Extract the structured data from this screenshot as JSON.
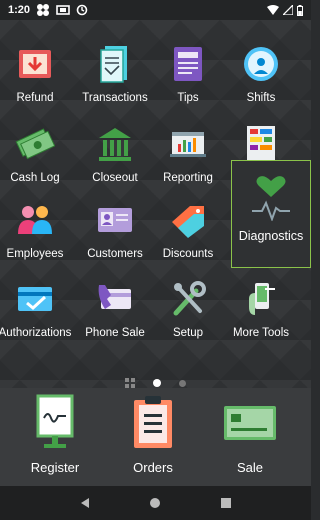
{
  "status_bar": {
    "time": "1:20",
    "icons": [
      "fan-icon",
      "cast-icon",
      "sync-icon"
    ],
    "right_icons": [
      "wifi-icon",
      "signal-icon",
      "battery-icon"
    ]
  },
  "apps": [
    {
      "label": "Refund",
      "icon": "refund-icon"
    },
    {
      "label": "Transactions",
      "icon": "transactions-icon"
    },
    {
      "label": "Tips",
      "icon": "tips-icon"
    },
    {
      "label": "Shifts",
      "icon": "shifts-icon"
    },
    {
      "label": "Cash Log",
      "icon": "cash-log-icon"
    },
    {
      "label": "Closeout",
      "icon": "closeout-icon"
    },
    {
      "label": "Reporting",
      "icon": "reporting-icon"
    },
    {
      "label": "",
      "icon": "inventory-icon"
    },
    {
      "label": "Employees",
      "icon": "employees-icon"
    },
    {
      "label": "Customers",
      "icon": "customers-icon"
    },
    {
      "label": "Discounts",
      "icon": "discounts-icon"
    },
    {
      "label": "Authorizations",
      "icon": "authorizations-icon"
    },
    {
      "label": "Phone Sale",
      "icon": "phone-sale-icon"
    },
    {
      "label": "Setup",
      "icon": "setup-icon"
    },
    {
      "label": "More Tools",
      "icon": "more-tools-icon"
    }
  ],
  "popup": {
    "label": "Diagnostics",
    "icon": "diagnostics-icon",
    "accent": "#8bc34a"
  },
  "page_indicator": {
    "pages": 2,
    "current": 1
  },
  "dock": [
    {
      "label": "Register",
      "icon": "register-icon"
    },
    {
      "label": "Orders",
      "icon": "orders-icon"
    },
    {
      "label": "Sale",
      "icon": "sale-icon"
    }
  ],
  "navbar": [
    "back-icon",
    "home-icon",
    "recents-icon"
  ]
}
